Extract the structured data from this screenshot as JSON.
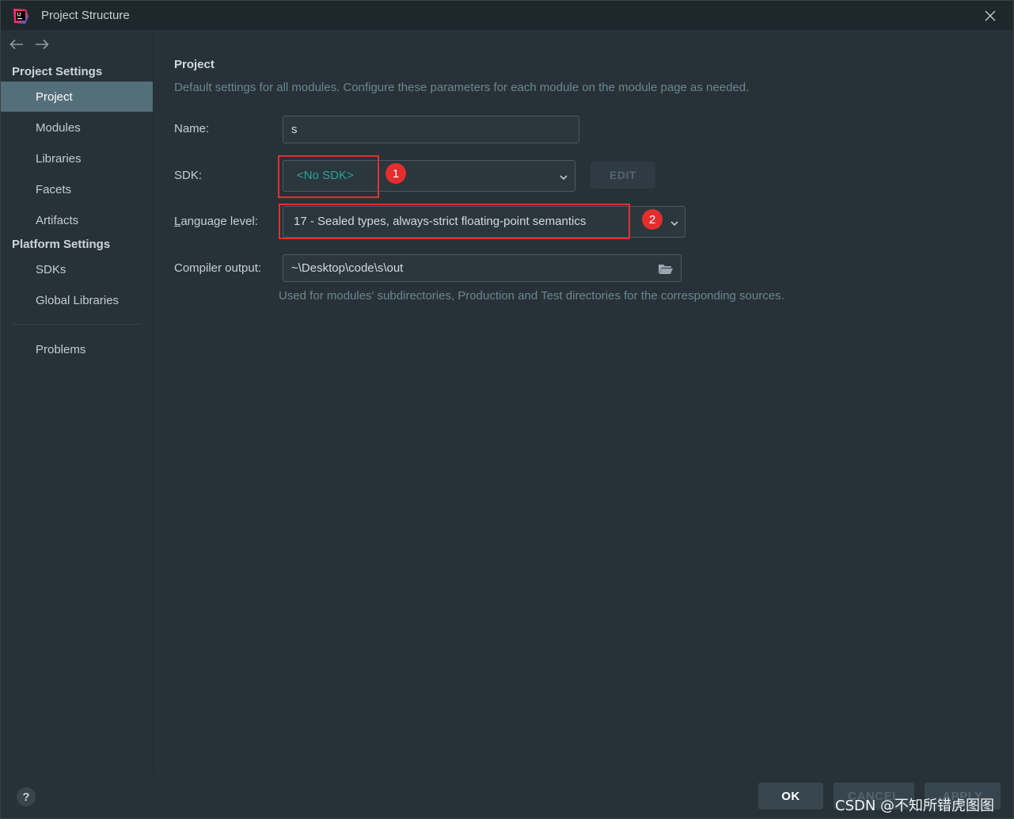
{
  "window": {
    "title": "Project Structure",
    "logo_icon": "intellij-logo-icon",
    "close_icon": "close-icon"
  },
  "nav": {
    "back_icon": "arrow-left-icon",
    "forward_icon": "arrow-right-icon"
  },
  "sidebar": {
    "project_settings_header": "Project Settings",
    "project_items": [
      {
        "label": "Project",
        "selected": true
      },
      {
        "label": "Modules"
      },
      {
        "label": "Libraries"
      },
      {
        "label": "Facets"
      },
      {
        "label": "Artifacts"
      }
    ],
    "platform_settings_header": "Platform Settings",
    "platform_items": [
      {
        "label": "SDKs"
      },
      {
        "label": "Global Libraries"
      }
    ],
    "problems_label": "Problems"
  },
  "main": {
    "title": "Project",
    "description": "Default settings for all modules. Configure these parameters for each module on the module page as needed.",
    "name_label": "Name:",
    "name_value": "s",
    "sdk_label": "SDK:",
    "sdk_value": "<No SDK>",
    "edit_button": "EDIT",
    "language_label_prefix": "L",
    "language_label_rest": "anguage level:",
    "language_value": "17 - Sealed types, always-strict floating-point semantics",
    "compiler_label": "Compiler output:",
    "compiler_value": "~\\Desktop\\code\\s\\out",
    "compiler_hint": "Used for modules' subdirectories, Production and Test directories for the corresponding sources."
  },
  "annotations": {
    "badge_1": "1",
    "badge_2": "2",
    "highlight_color": "#e0312f"
  },
  "footer": {
    "help": "?",
    "ok": "OK",
    "cancel": "CANCEL",
    "apply": "APPLY"
  },
  "watermark": "CSDN @不知所错虎图图",
  "colors": {
    "background": "#263238",
    "selected": "#546e7a",
    "sdk_text": "#26a69a"
  }
}
